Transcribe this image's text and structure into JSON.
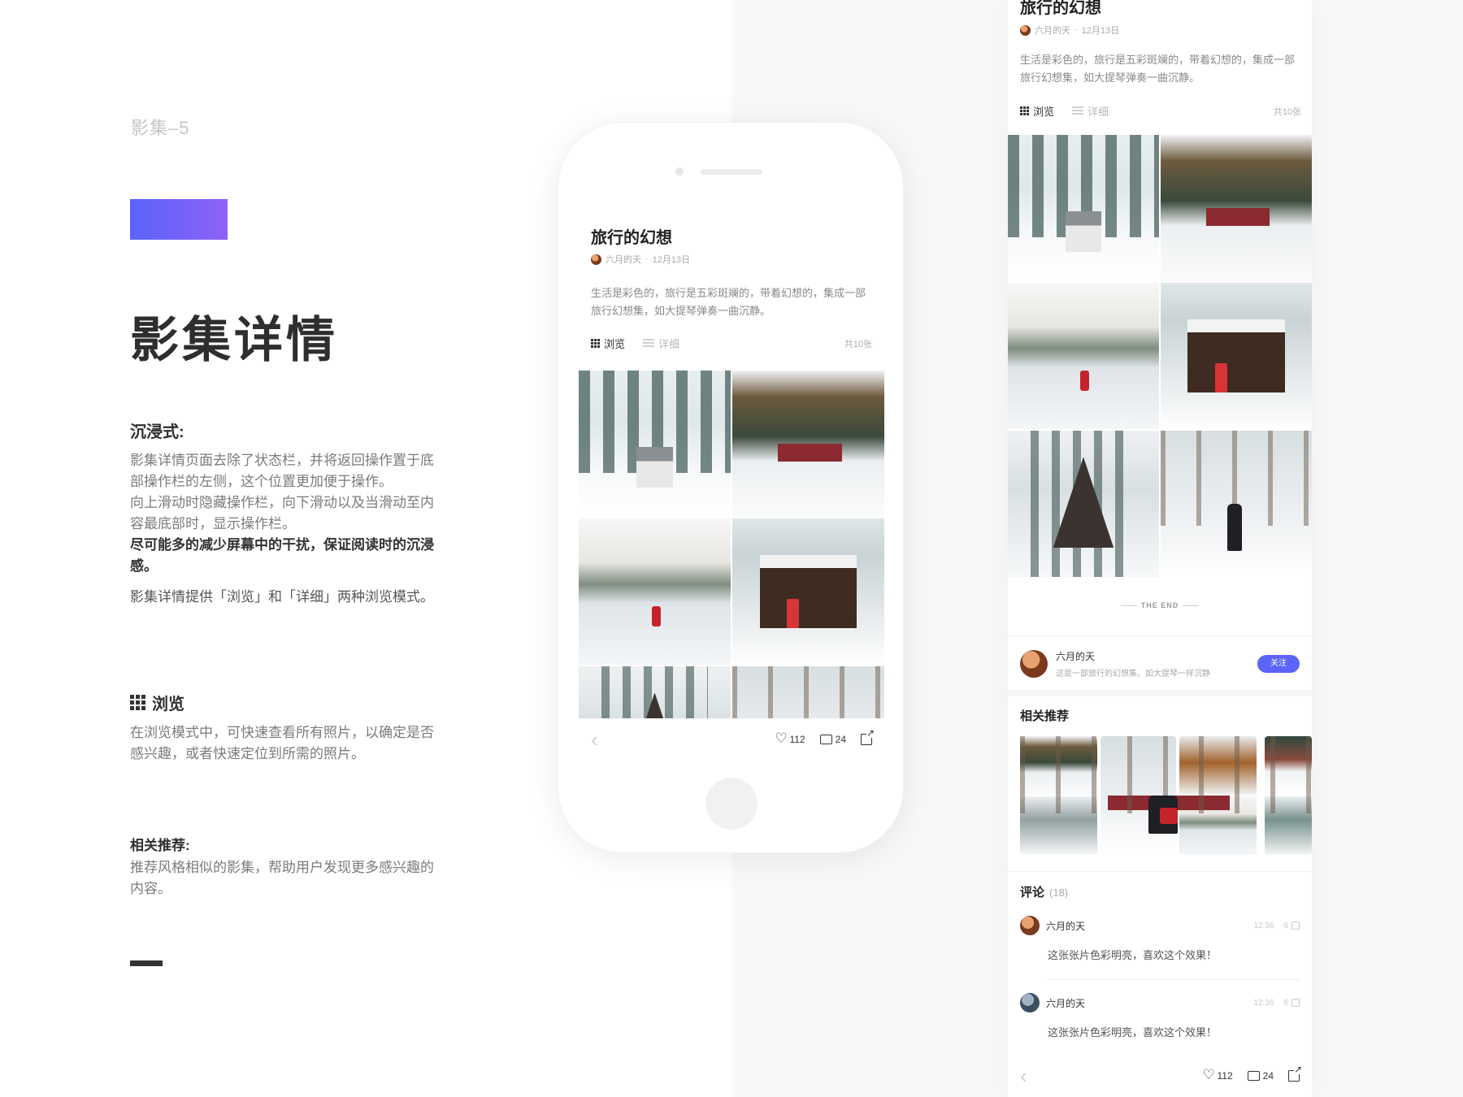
{
  "left": {
    "label": "影集–5",
    "title": "影集详情",
    "sections": {
      "immersive": {
        "heading": "沉浸式:",
        "p1": "影集详情页面去除了状态栏，并将返回操作置于底部操作栏的左侧，这个位置更加便于操作。",
        "p2": "向上滑动时隐藏操作栏，向下滑动以及当滑动至内容最底部时，显示操作栏。",
        "p3": "尽可能多的减少屏幕中的干扰，保证阅读时的沉浸感。",
        "p4": "影集详情提供「浏览」和「详细」两种浏览模式。"
      },
      "browse": {
        "heading": "浏览",
        "text": "在浏览模式中，可快速查看所有照片，以确定是否感兴趣，或者快速定位到所需的照片。"
      },
      "related": {
        "heading": "相关推荐:",
        "text": "推荐风格相似的影集，帮助用户发现更多感兴趣的内容。"
      }
    }
  },
  "album": {
    "title": "旅行的幻想",
    "author": "六月的天",
    "date": "12月13日",
    "meta_sep": "·",
    "description": "生活是彩色的，旅行是五彩斑斓的，带着幻想的，集成一部旅行幻想集，如大提琴弹奏一曲沉静。",
    "tab_browse": "浏览",
    "tab_detail": "详细",
    "count": "共10张"
  },
  "actions": {
    "back_icon": "‹",
    "likes": "112",
    "comments": "24"
  },
  "long": {
    "the_end": "THE END",
    "author_name": "六月的天",
    "author_sub": "这是一部旅行的幻想集。如大提琴一样沉静",
    "follow": "关注",
    "related_heading": "相关推荐",
    "comments_heading": "评论",
    "comments_count": "(18)",
    "comments": [
      {
        "name": "六月的天",
        "time": "12:36",
        "likes": "6",
        "text": "这张张片色彩明亮，喜欢这个效果！"
      },
      {
        "name": "六月的天",
        "time": "12:36",
        "likes": "6",
        "text": "这张张片色彩明亮，喜欢这个效果！"
      }
    ]
  },
  "colors": {
    "accent": "#5b64f7",
    "gradient_start": "#5a63fb",
    "gradient_end": "#8f62f7"
  },
  "icons": [
    "grid-icon",
    "list-icon",
    "heart-icon",
    "comment-icon",
    "share-icon",
    "back-icon",
    "thumb-up-icon"
  ]
}
